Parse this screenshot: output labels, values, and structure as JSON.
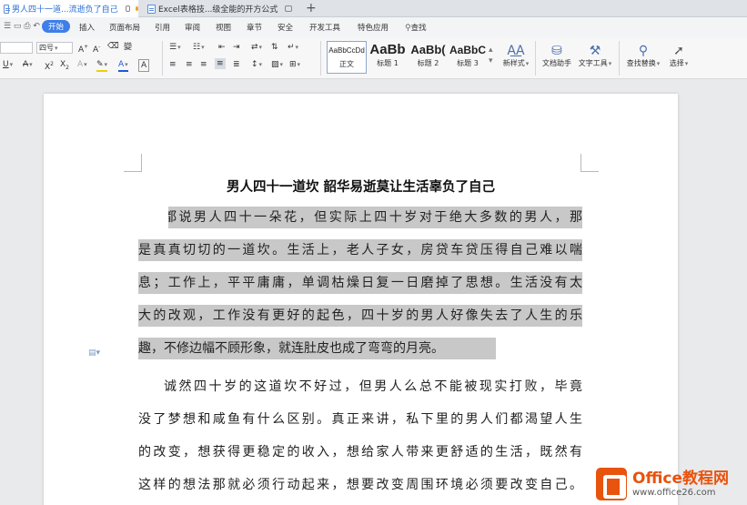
{
  "tabs": [
    {
      "label": "男人四十一道...流逝负了自己"
    },
    {
      "label": "Excel表格技...级全能的开方公式"
    }
  ],
  "menu": {
    "items": [
      "开始",
      "插入",
      "页面布局",
      "引用",
      "审阅",
      "视图",
      "章节",
      "安全",
      "开发工具",
      "特色应用",
      "查找"
    ],
    "active": "开始"
  },
  "ribbon": {
    "font_size": "四号",
    "styles": [
      {
        "sample": "AaBbCcDd",
        "label": "正文"
      },
      {
        "sample": "AaBb",
        "label": "标题 1"
      },
      {
        "sample": "AaBb(",
        "label": "标题 2"
      },
      {
        "sample": "AaBbC",
        "label": "标题 3"
      }
    ],
    "new_style": "新样式",
    "doc_assistant": "文档助手",
    "text_tools": "文字工具",
    "find_replace": "查找替换",
    "select": "选择"
  },
  "document": {
    "title": "男人四十一道坎  韶华易逝莫让生活辜负了自己",
    "lines": [
      "都说男人四十一朵花，但实际上四十岁对于绝大多数的男人，那",
      "是真真切切的一道坎。生活上，老人子女，房贷车贷压得自己难以喘",
      "息；工作上，平平庸庸，单调枯燥日复一日磨掉了思想。生活没有太",
      "大的改观，工作没有更好的起色，四十岁的男人好像失去了人生的乐",
      "趣，不修边幅不顾形象，就连肚皮也成了弯弯的月亮。",
      "诚然四十岁的这道坎不好过，但男人么总不能被现实打败，毕竟",
      "没了梦想和咸鱼有什么区别。真正来讲，私下里的男人们都渴望人生",
      "的改变，想获得更稳定的收入，想给家人带来更舒适的生活，既然有",
      "这样的想法那就必须行动起来，想要改变周围环境必须要改变自己。"
    ]
  },
  "watermark": {
    "name": "Office教程网",
    "url": "www.office26.com"
  },
  "colors": {
    "accent": "#3f7ee8",
    "highlight": "#c8c8c8",
    "brand": "#e8530e"
  }
}
